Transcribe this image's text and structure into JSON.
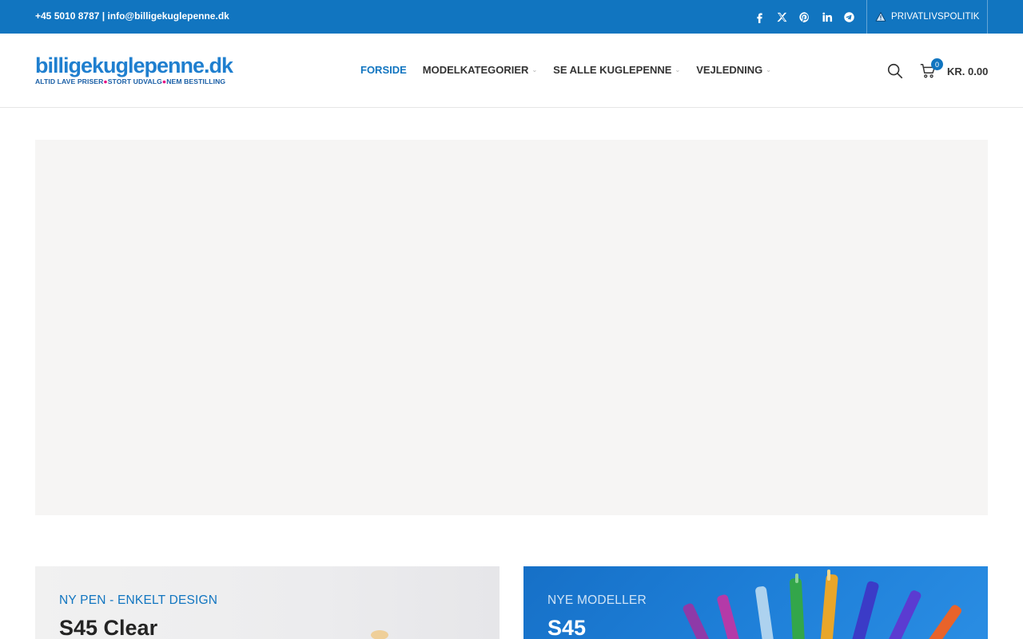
{
  "topbar": {
    "contact": "+45 5010 8787 | info@billigekuglepenne.dk",
    "socials": [
      "facebook-icon",
      "x-icon",
      "pinterest-icon",
      "linkedin-icon",
      "telegram-icon"
    ],
    "privacy_label": "PRIVATLIVSPOLITIK",
    "background": "#1175c0"
  },
  "header": {
    "logo": {
      "main": "billigekuglepenne.dk",
      "tag_1": "ALTID LAVE PRISER",
      "tag_2": "STORT UDVALG",
      "tag_3": "NEM BESTILLING"
    },
    "nav": [
      {
        "label": "FORSIDE",
        "active": true
      },
      {
        "label": "MODELKATEGORIER",
        "active": false
      },
      {
        "label": "SE ALLE KUGLEPENNE",
        "active": false
      },
      {
        "label": "VEJLEDNING",
        "active": false
      }
    ],
    "cart": {
      "count": "0",
      "total": "KR. 0.00"
    }
  },
  "cards": [
    {
      "eyebrow": "NY PEN - ENKELT DESIGN",
      "heading": "S45 Clear"
    },
    {
      "eyebrow": "NYE MODELLER",
      "heading": "S45"
    }
  ],
  "colors": {
    "accent": "#1175c0",
    "hero_placeholder": "#f6f5f4"
  }
}
